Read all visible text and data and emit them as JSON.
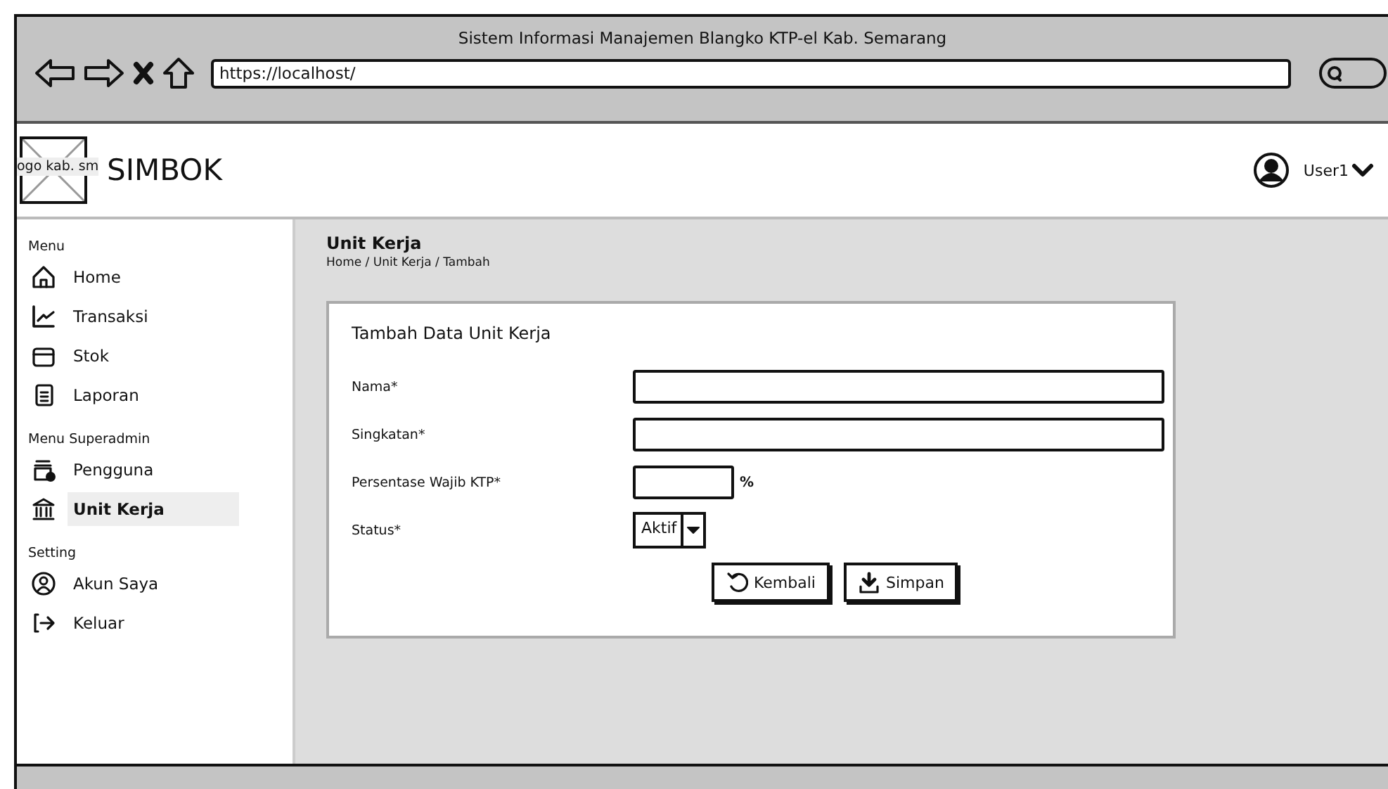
{
  "window": {
    "title": "Sistem Informasi Manajemen Blangko KTP-el Kab. Semarang",
    "url": "https://localhost/"
  },
  "header": {
    "logo_placeholder": "ogo kab. sm",
    "app_name": "SIMBOK",
    "user": "User1"
  },
  "sidebar": {
    "sections": [
      {
        "title": "Menu",
        "items": [
          {
            "label": "Home",
            "selected": false
          },
          {
            "label": "Transaksi",
            "selected": false
          },
          {
            "label": "Stok",
            "selected": false
          },
          {
            "label": "Laporan",
            "selected": false
          }
        ]
      },
      {
        "title": "Menu Superadmin",
        "items": [
          {
            "label": "Pengguna",
            "selected": false
          },
          {
            "label": "Unit Kerja",
            "selected": true
          }
        ]
      },
      {
        "title": "Setting",
        "items": [
          {
            "label": "Akun Saya",
            "selected": false
          },
          {
            "label": "Keluar",
            "selected": false
          }
        ]
      }
    ]
  },
  "page": {
    "title": "Unit Kerja",
    "breadcrumb": "Home / Unit Kerja / Tambah"
  },
  "form": {
    "title": "Tambah Data Unit Kerja",
    "fields": [
      {
        "label": "Nama*",
        "kind": "text"
      },
      {
        "label": "Singkatan*",
        "kind": "text"
      },
      {
        "label": "Persentase Wajib KTP*",
        "kind": "percent",
        "suffix": "%"
      },
      {
        "label": "Status*",
        "kind": "select",
        "value": "Aktif"
      }
    ],
    "buttons": [
      {
        "label": "Kembali"
      },
      {
        "label": "Simpan"
      }
    ]
  }
}
